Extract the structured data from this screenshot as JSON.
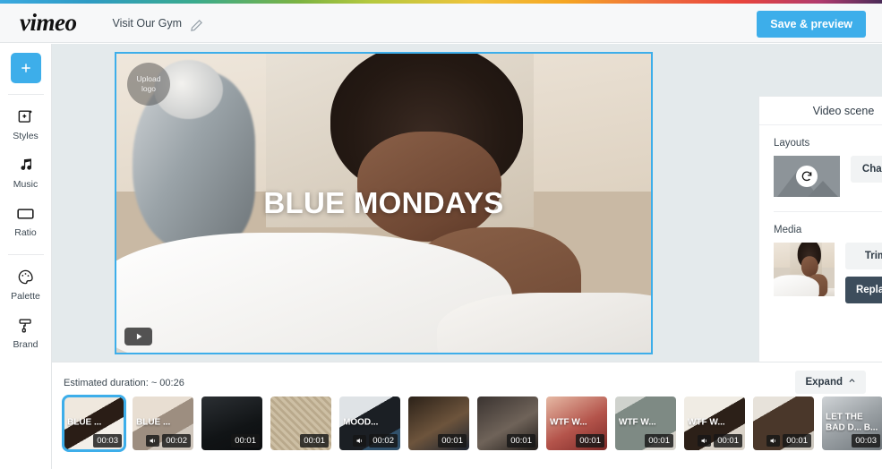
{
  "header": {
    "logo": "vimeo",
    "project_name": "Visit Our Gym",
    "edit_icon": "pencil-icon",
    "save_label": "Save & preview",
    "accent_color": "#3daeea"
  },
  "sidebar": {
    "add_label": "+",
    "items": [
      {
        "label": "Styles",
        "icon": "styles-icon"
      },
      {
        "label": "Music",
        "icon": "music-note-icon"
      },
      {
        "label": "Ratio",
        "icon": "ratio-icon"
      },
      {
        "label": "Palette",
        "icon": "palette-icon"
      },
      {
        "label": "Brand",
        "icon": "brand-roller-icon"
      }
    ]
  },
  "preview": {
    "upload_logo_line1": "Upload",
    "upload_logo_line2": "logo",
    "title": "BLUE MONDAYS",
    "play_icon": "play-icon"
  },
  "panel": {
    "title": "Video scene",
    "layouts_label": "Layouts",
    "layout_refresh_icon": "refresh-icon",
    "change_label": "Change",
    "media_label": "Media",
    "trim_label": "Trim",
    "replace_label": "Replace",
    "replace_color": "#3d4d5c"
  },
  "timeline": {
    "duration_text": "Estimated duration: ~ 00:26",
    "expand_label": "Expand",
    "expand_icon": "chevron-up-icon",
    "clips": [
      {
        "title": "BLUE ...",
        "duration": "00:03",
        "sound": false,
        "selected": true,
        "theme": "bed"
      },
      {
        "title": "BLUE ...",
        "duration": "00:02",
        "sound": true,
        "selected": false,
        "theme": "bed2"
      },
      {
        "title": "",
        "duration": "00:01",
        "sound": false,
        "selected": false,
        "theme": "dark"
      },
      {
        "title": "",
        "duration": "00:01",
        "sound": false,
        "selected": false,
        "theme": "mesh"
      },
      {
        "title": "MOOD...",
        "duration": "00:02",
        "sound": true,
        "selected": false,
        "theme": "hands"
      },
      {
        "title": "",
        "duration": "00:01",
        "sound": false,
        "selected": false,
        "theme": "dog"
      },
      {
        "title": "",
        "duration": "00:01",
        "sound": false,
        "selected": false,
        "theme": "blur"
      },
      {
        "title": "WTF W...",
        "duration": "00:01",
        "sound": false,
        "selected": false,
        "theme": "mouth"
      },
      {
        "title": "WTF W...",
        "duration": "00:01",
        "sound": false,
        "selected": false,
        "theme": "tv"
      },
      {
        "title": "WTF W...",
        "duration": "00:01",
        "sound": true,
        "selected": false,
        "theme": "bed3"
      },
      {
        "title": "",
        "duration": "00:01",
        "sound": true,
        "selected": false,
        "theme": "man"
      },
      {
        "title": "LET THE BAD D... B...",
        "duration": "00:03",
        "sound": false,
        "selected": false,
        "theme": "light"
      }
    ]
  }
}
